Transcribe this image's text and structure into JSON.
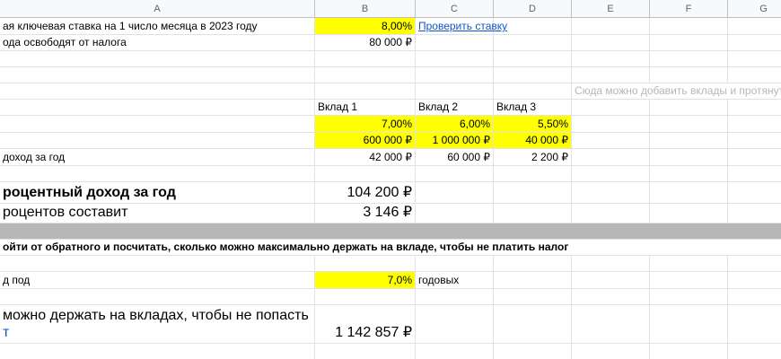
{
  "columns": [
    "A",
    "B",
    "C",
    "D",
    "E",
    "F",
    "G"
  ],
  "rows": {
    "r1": {
      "a": "ая ключевая ставка на 1 число месяца в 2023 году",
      "b": "8,00%",
      "c": "Проверить ставку"
    },
    "r2": {
      "a": "ода освободят от налога",
      "b": "80 000 ₽"
    },
    "r5": {
      "e": "Сюда можно добавить вклады и протянуть"
    },
    "r6": {
      "b": "Вклад 1",
      "c": "Вклад 2",
      "d": "Вклад 3"
    },
    "r7": {
      "b": "7,00%",
      "c": "6,00%",
      "d": "5,50%"
    },
    "r8": {
      "b": "600 000 ₽",
      "c": "1 000 000 ₽",
      "d": "40 000 ₽"
    },
    "r9": {
      "a": "доход за год",
      "b": "42 000 ₽",
      "c": "60 000 ₽",
      "d": "2 200 ₽"
    },
    "r11": {
      "a": "роцентный доход за год",
      "b": "104 200 ₽"
    },
    "r12": {
      "a": "роцентов составит",
      "b": "3 146 ₽"
    },
    "r14": {
      "a": "ойти от обратного и посчитать, сколько можно максимально держать на вкладе, чтобы не платить налог"
    },
    "r16": {
      "a": "д под",
      "b": "7,0%",
      "c": "годовых"
    },
    "r18": {
      "a1": "можно держать на вкладах, чтобы не попасть",
      "a2": "т",
      "b": "1 142 857 ₽"
    }
  }
}
